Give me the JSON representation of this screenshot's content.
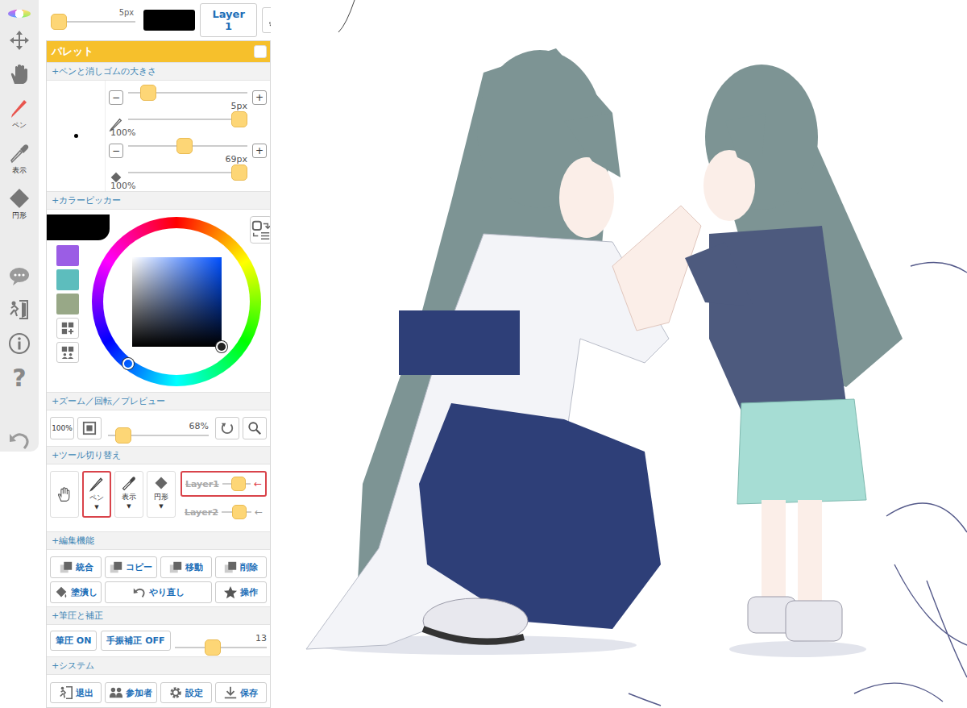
{
  "side_tools": [
    {
      "label": "ペン",
      "selected": true
    },
    {
      "label": "表示",
      "selected": false
    },
    {
      "label": "円形",
      "selected": false
    }
  ],
  "help_key": "?",
  "top_bar": {
    "size": "5px",
    "level": 0.0,
    "current_color": "#000000",
    "layer": "Layer 1"
  },
  "palette": {
    "title": "パレット",
    "pinned": false
  },
  "size": {
    "heading": "+ペンと消しゴムの大きさ",
    "minus": "−",
    "plus": "+",
    "pen": {
      "size": "5px",
      "size_level": 0.12,
      "opacity": "100%",
      "opacity_level": 1
    },
    "eraser": {
      "size": "69px",
      "size_level": 0.47,
      "opacity": "100%",
      "opacity_level": 1
    }
  },
  "color_picker": {
    "heading": "+カラーピッカー",
    "current_color": "#000000",
    "hue_angle": 218,
    "saturation": 1,
    "value": 0,
    "swatches": [
      {
        "color": "#9b5de5"
      },
      {
        "color": "#5dbdbd"
      },
      {
        "color": "#98a887"
      }
    ]
  },
  "zoom": {
    "heading": "+ズーム／回転／プレビュー",
    "reset": "100%",
    "level": 0.09,
    "reading": "68%"
  },
  "tools": {
    "heading": "+ツール切り替え",
    "items": [
      {
        "kind": "hand",
        "label": null,
        "arrow": null,
        "selected": false
      },
      {
        "kind": "pen",
        "label": "ペン",
        "arrow": "▼",
        "selected": true
      },
      {
        "kind": "picker",
        "label": "表示",
        "arrow": "▼",
        "selected": false
      },
      {
        "kind": "eraser",
        "label": "円形",
        "arrow": "▼",
        "selected": false
      }
    ],
    "layers": [
      {
        "label": "Layer1",
        "arrow": "←",
        "selected": true,
        "level": 0.75
      },
      {
        "label": "Layer2",
        "arrow": "←",
        "selected": false,
        "level": 0.75
      }
    ]
  },
  "edit": {
    "heading": "+編集機能",
    "buttons": [
      {
        "label": "統合"
      },
      {
        "label": "コピー"
      },
      {
        "label": "移動"
      },
      {
        "label": "削除"
      },
      {
        "label": "塗潰し"
      },
      {
        "label": "やり直し"
      },
      {
        "label": "操作"
      }
    ]
  },
  "pressure": {
    "heading": "+筆圧と補正",
    "pressure": "筆圧 ON",
    "stabilizer": "手振補正 OFF",
    "level": 0.4,
    "reading": "13"
  },
  "system": {
    "heading": "+システム",
    "buttons": [
      {
        "label": "退出"
      },
      {
        "label": "参加者"
      },
      {
        "label": "設定"
      },
      {
        "label": "保存"
      }
    ]
  }
}
